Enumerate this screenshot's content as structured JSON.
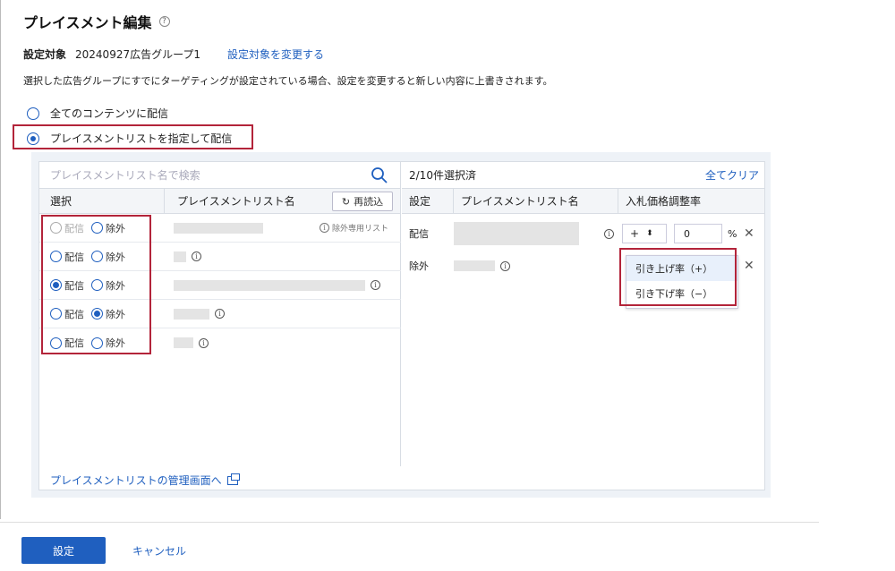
{
  "page": {
    "title": "プレイスメント編集",
    "help_icon": "question-circle-icon",
    "target_label": "設定対象",
    "target_value": "20240927広告グループ1",
    "change_target_link": "設定対象を変更する",
    "notice": "選択した広告グループにすでにターゲティングが設定されている場合、設定を変更すると新しい内容に上書きされます。",
    "option_all": "全てのコンテンツに配信",
    "option_list": "プレイスメントリストを指定して配信"
  },
  "left_panel": {
    "search_placeholder": "プレイスメントリスト名で検索",
    "col_select": "選択",
    "col_name": "プレイスメントリスト名",
    "reload_label": "再読込",
    "deliver_label": "配信",
    "exclude_label": "除外",
    "exclude_only_label": "除外専用リスト",
    "manage_link": "プレイスメントリストの管理画面へ"
  },
  "right_panel": {
    "selected_count": "2/10件選択済",
    "clear_all": "全てクリア",
    "col_setting": "設定",
    "col_name": "プレイスメントリスト名",
    "col_bid": "入札価格調整率",
    "row1_setting": "配信",
    "row1_sign": "+",
    "row1_value": "0",
    "pct": "%",
    "row2_setting": "除外",
    "dropdown_up": "引き上げ率（+）",
    "dropdown_down": "引き下げ率（−）"
  },
  "footer": {
    "submit": "設定",
    "cancel": "キャンセル"
  },
  "colors": {
    "accent": "#1f5fbf",
    "highlight_border": "#b3243a"
  }
}
